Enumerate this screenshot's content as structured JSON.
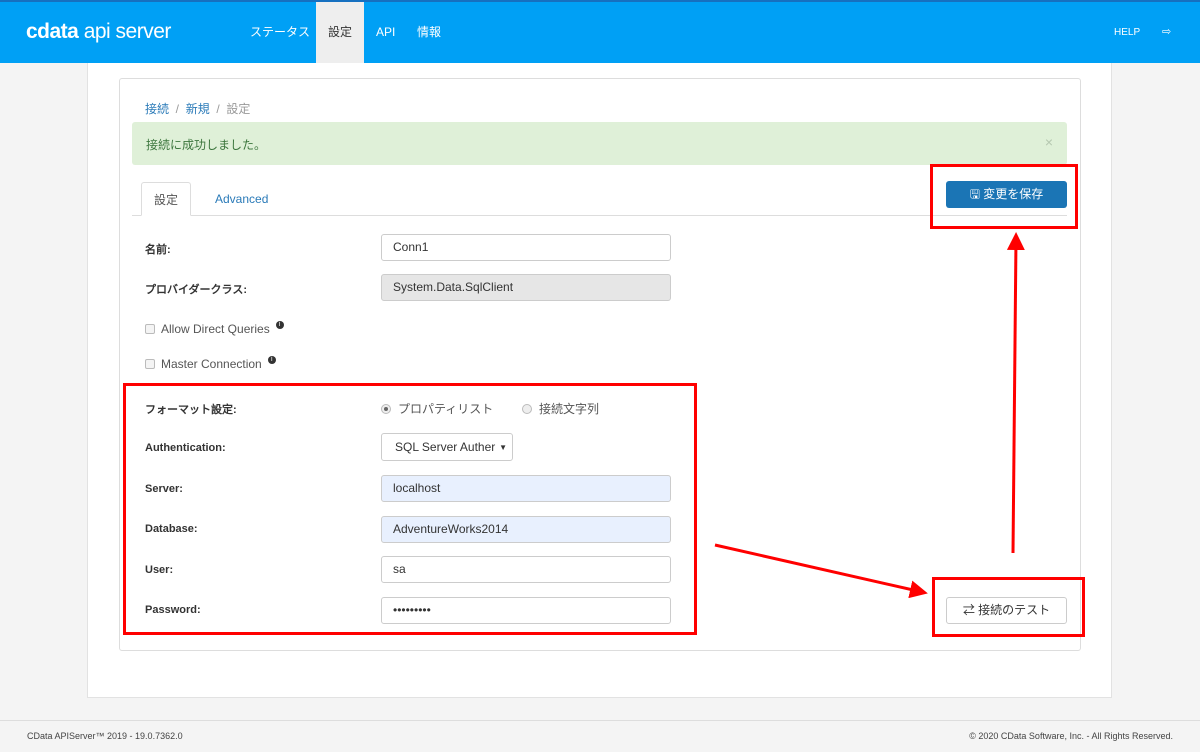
{
  "header": {
    "logo": "cdata api server",
    "nav": [
      "ステータス",
      "設定",
      "API",
      "情報"
    ],
    "active_nav": "設定",
    "help": "HELP",
    "logout_icon": "sign-out-icon"
  },
  "breadcrumb": {
    "items": [
      "接続",
      "新規",
      "設定"
    ]
  },
  "alert": {
    "message": "接続に成功しました。",
    "close": "×"
  },
  "tabs": [
    "設定",
    "Advanced"
  ],
  "buttons": {
    "save": "変更を保存",
    "test": "接続のテスト",
    "save_icon": "floppy-icon",
    "test_icon": "exchange-icon"
  },
  "form": {
    "name_label": "名前:",
    "name_value": "Conn1",
    "provider_label": "プロバイダークラス:",
    "provider_value": "System.Data.SqlClient",
    "allow_direct": "Allow Direct Queries",
    "master_conn": "Master Connection",
    "format_label": "フォーマット設定:",
    "format_options": [
      "プロパティリスト",
      "接続文字列"
    ],
    "format_selected": "プロパティリスト",
    "auth_label": "Authentication:",
    "auth_value": "SQL Server Auther",
    "server_label": "Server:",
    "server_value": "localhost",
    "database_label": "Database:",
    "database_value": "AdventureWorks2014",
    "user_label": "User:",
    "user_value": "sa",
    "password_label": "Password:",
    "password_value": "•••••••••"
  },
  "footer": {
    "left": "CData APIServer™ 2019 - 19.0.7362.0",
    "right": "© 2020 CData Software, Inc. - All Rights Reserved."
  },
  "colors": {
    "header": "#00a0f5",
    "primary": "#1b75b5",
    "highlight": "#ff0000"
  }
}
